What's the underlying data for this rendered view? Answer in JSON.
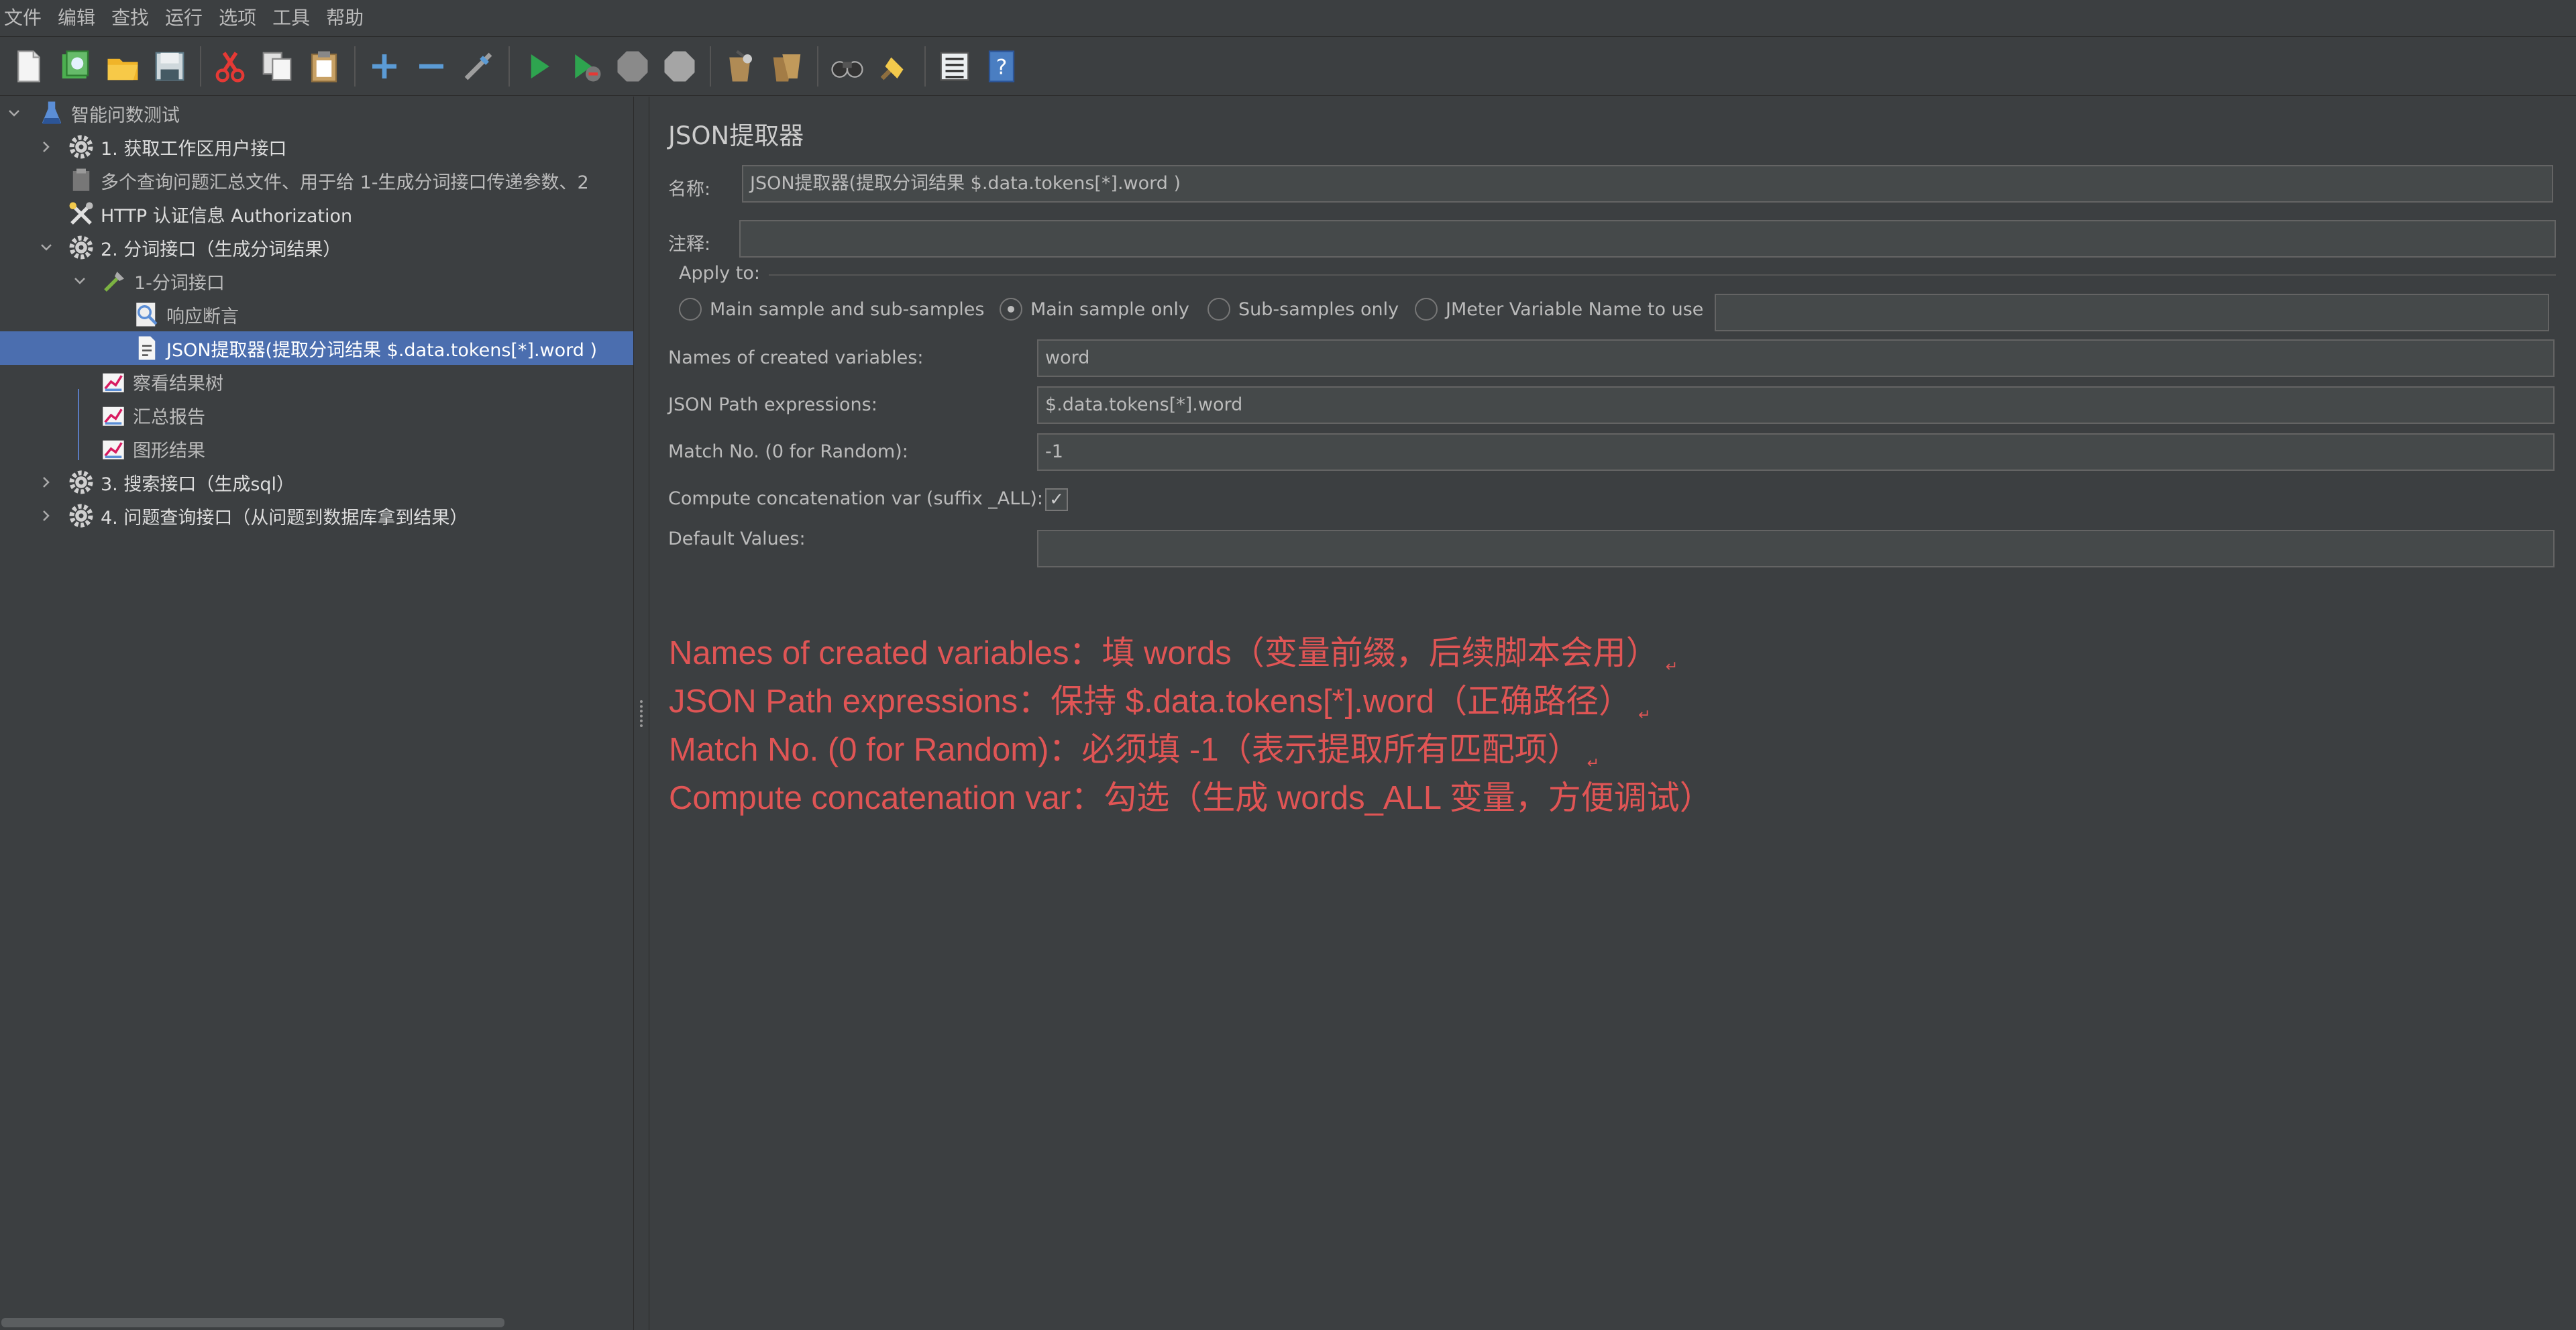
{
  "menu": [
    "文件",
    "编辑",
    "查找",
    "运行",
    "选项",
    "工具",
    "帮助"
  ],
  "toolbar_icons": [
    "new-icon",
    "templates-icon",
    "open-icon",
    "save-icon",
    "cut-icon",
    "copy-icon",
    "paste-icon",
    "expand-icon",
    "collapse-icon",
    "toggle-icon",
    "start-icon",
    "start-no-pause-icon",
    "stop-icon",
    "shutdown-icon",
    "clear-icon",
    "clear-all-icon",
    "search-icon",
    "reset-search-icon",
    "function-helper-icon",
    "help-icon"
  ],
  "tree": [
    {
      "label": "智能问数测试",
      "icon": "test-plan-icon",
      "expanded": true
    },
    {
      "label": "1. 获取工作区用户接口",
      "icon": "thread-group-icon",
      "expanded": false
    },
    {
      "label": "多个查询问题汇总文件、用于给 1-生成分词接口传递参数、2",
      "icon": "csv-data-icon"
    },
    {
      "label": "HTTP 认证信息 Authorization",
      "icon": "auth-manager-icon"
    },
    {
      "label": "2. 分词接口（生成分词结果）",
      "icon": "thread-group-icon",
      "expanded": true
    },
    {
      "label": "1-分词接口",
      "icon": "http-sampler-icon",
      "expanded": true
    },
    {
      "label": "响应断言",
      "icon": "assertion-icon"
    },
    {
      "label": "JSON提取器(提取分词结果 $.data.tokens[*].word )",
      "icon": "json-extractor-icon",
      "selected": true
    },
    {
      "label": "察看结果树",
      "icon": "listener-icon"
    },
    {
      "label": "汇总报告",
      "icon": "listener-icon"
    },
    {
      "label": "图形结果",
      "icon": "listener-icon"
    },
    {
      "label": "3. 搜索接口（生成sql）",
      "icon": "thread-group-icon",
      "expanded": false
    },
    {
      "label": "4. 问题查询接口（从问题到数据库拿到结果）",
      "icon": "thread-group-icon",
      "expanded": false
    }
  ],
  "panel": {
    "title": "JSON提取器",
    "name_label": "名称:",
    "name_value": "JSON提取器(提取分词结果 $.data.tokens[*].word )",
    "comment_label": "注释:",
    "comment_value": "",
    "apply_to_label": "Apply to:",
    "apply_options": [
      "Main sample and sub-samples",
      "Main sample only",
      "Sub-samples only",
      "JMeter Variable Name to use"
    ],
    "apply_selected": "Main sample only",
    "variable_name_value": "",
    "vars_label": "Names of created variables:",
    "vars_value": "word",
    "path_label": "JSON Path expressions:",
    "path_value": "$.data.tokens[*].word",
    "match_label": "Match No. (0 for Random):",
    "match_value": "-1",
    "concat_label": "Compute concatenation var (suffix _ALL):",
    "concat_checked": true,
    "default_label": "Default Values:",
    "default_value": ""
  },
  "notes": [
    "Names of created variables：填 words（变量前缀，后续脚本会用）",
    "JSON Path expressions：保持 $.data.tokens[*].word（正确路径）",
    "Match No. (0 for Random)：必须填 -1（表示提取所有匹配项）",
    "Compute concatenation var：勾选（生成 words_ALL 变量，方便调试）"
  ],
  "colors": {
    "background": "#3c3f41",
    "selection": "#4b6eaf",
    "note_red": "#e05555",
    "field_bg": "#45494a"
  }
}
